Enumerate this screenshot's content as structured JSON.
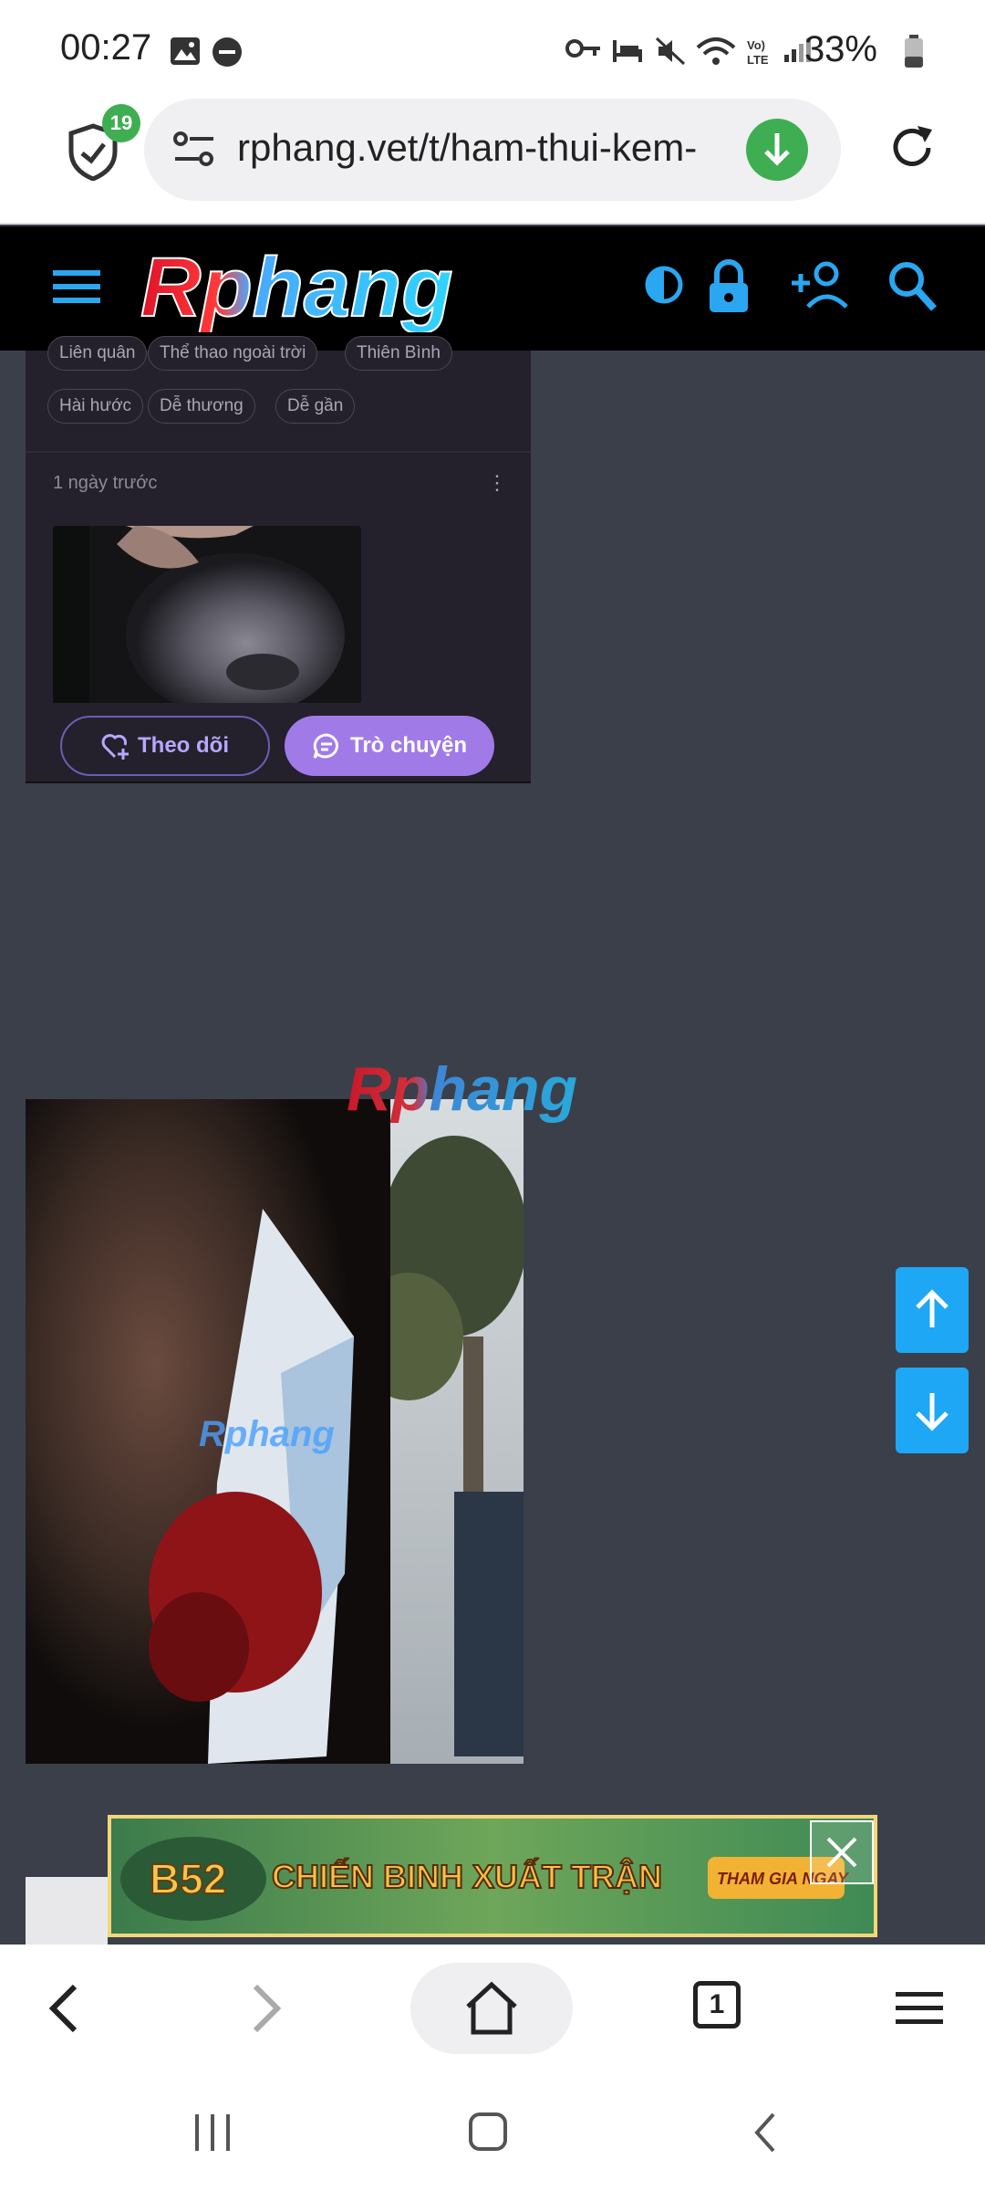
{
  "status_bar": {
    "time": "00:27",
    "battery": "33%",
    "icons": [
      "image-icon",
      "dnd-icon",
      "key-icon",
      "bed-icon",
      "mute-icon",
      "wifi-icon",
      "volte-icon",
      "signal-icon",
      "battery-icon"
    ]
  },
  "browser": {
    "shield_badge": "19",
    "url": "rphang.vet/t/ham-thui-kem-",
    "accent": "#3fae52"
  },
  "site": {
    "logo_text": "Rphang",
    "nav_bg": "#000000",
    "icons": [
      "menu-icon",
      "contrast-icon",
      "lock-icon",
      "add-user-icon",
      "search-icon"
    ]
  },
  "card": {
    "tags_row1": [
      "Liên quân",
      "Thể thao ngoài trời",
      "Thiên Bình"
    ],
    "tags_row2": [
      "Hài hước",
      "Dễ thương",
      "Dễ gần"
    ],
    "time_ago": "1 ngày trước",
    "more": "⋮",
    "follow_label": "Theo dõi",
    "chat_label": "Trò chuyện",
    "chat_color": "#a07be8"
  },
  "watermark": "Rphang",
  "ad": {
    "badge": "B52",
    "headline": "CHIẾN BINH XUẤT TRẬN",
    "cta": "THAM GIA NGAY"
  },
  "toolbar": {
    "tab_count": "1"
  },
  "scroll": {
    "color": "#1ea7f5"
  }
}
